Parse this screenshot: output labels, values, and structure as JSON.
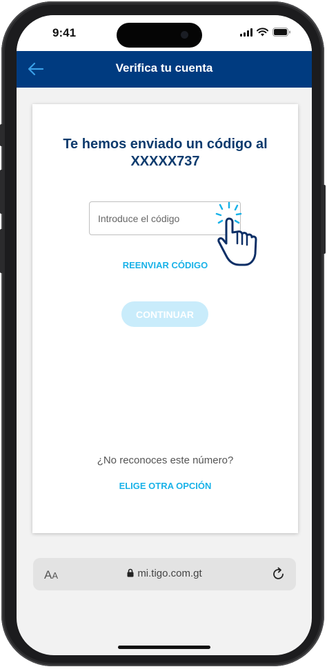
{
  "status_bar": {
    "time": "9:41"
  },
  "header": {
    "title": "Verifica tu cuenta",
    "back_icon": "arrow-left-icon"
  },
  "card": {
    "heading": "Te hemos enviado un código al XXXXX737",
    "code_input": {
      "placeholder": "Introduce el código",
      "value": ""
    },
    "resend_label": "REENVIAR CÓDIGO",
    "continue_label": "CONTINUAR",
    "question": "¿No reconoces este número?",
    "other_option_label": "ELIGE OTRA OPCIÓN"
  },
  "browser": {
    "text_size_label_large": "A",
    "text_size_label_small": "A",
    "url": "mi.tigo.com.gt"
  },
  "colors": {
    "header_bg": "#003b80",
    "heading_text": "#0d3b6e",
    "link": "#19b2e8",
    "button_disabled_bg": "#c9ecfb"
  }
}
